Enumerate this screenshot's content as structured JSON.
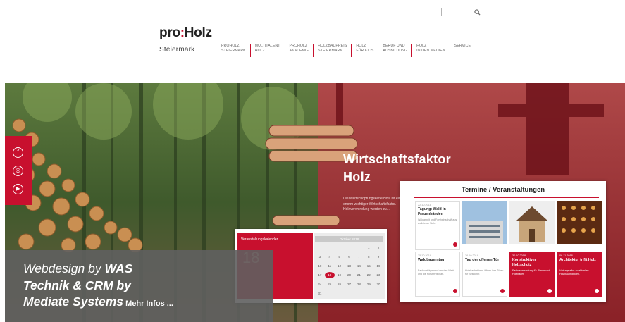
{
  "search": {
    "icon": "search-icon"
  },
  "logo": {
    "brand_a": "pro",
    "brand_sep": ":",
    "brand_b": "Holz",
    "region": "Steiermark"
  },
  "nav": [
    {
      "l1": "PROHOLZ",
      "l2": "STEIERMARK"
    },
    {
      "l1": "MULTITALENT",
      "l2": "HOLZ"
    },
    {
      "l1": "PROHOLZ",
      "l2": "AKADEMIE"
    },
    {
      "l1": "HOLZBAUPREIS",
      "l2": "STEIERMARK"
    },
    {
      "l1": "HOLZ",
      "l2": "FÜR KIDS"
    },
    {
      "l1": "BERUF UND",
      "l2": "AUSBILDUNG"
    },
    {
      "l1": "HOLZ",
      "l2": "IN DEN MEDIEN"
    },
    {
      "l1": "SERVICE",
      "l2": ""
    }
  ],
  "social": [
    "facebook-icon",
    "instagram-icon",
    "youtube-icon"
  ],
  "hero": {
    "title_1": "Wirtschaftsfaktor",
    "title_2": "Holz",
    "text": "Die Wertschöpfungskette Holz ist ein enorm wichtiger Wirtschaftsfaktor. Holzverwendung werden zu..."
  },
  "calendar_tablet": {
    "left_title": "Veranstaltungskalender",
    "big_number": "18",
    "month": "Oktober 2018",
    "days": [
      "",
      "",
      "",
      "",
      "",
      "1",
      "2",
      "3",
      "4",
      "5",
      "6",
      "7",
      "8",
      "9",
      "10",
      "11",
      "12",
      "13",
      "14",
      "15",
      "16",
      "17",
      "18",
      "19",
      "20",
      "21",
      "22",
      "23",
      "24",
      "25",
      "26",
      "27",
      "28",
      "29",
      "30",
      "31",
      "",
      ""
    ],
    "selected": "18"
  },
  "events_card": {
    "title": "Termine / Veranstaltungen",
    "items": [
      {
        "date": "22.10.2018",
        "title": "Tagung: Wald in Frauenhänden",
        "body": "Waldarbeit und Forstwirtschaft aus weiblicher Sicht.",
        "red": false
      },
      {
        "date": "25.10.2018",
        "title": "Waldbauerntag",
        "body": "Fachvorträge rund um den Wald und die Forstwirtschaft.",
        "red": false
      },
      {
        "date": "26.10.2018",
        "title": "Tag der offenen Tür",
        "body": "Holzbaubetriebe öffnen ihre Türen für Besucher.",
        "red": false
      },
      {
        "date": "30.10.2018",
        "title": "Konstruktiver Holzschutz",
        "body": "Fachveranstaltung für Planer und Holzbauer.",
        "red": true
      },
      {
        "date": "06.11.2018",
        "title": "Architektur trifft Holz",
        "body": "Vortragsreihe zu aktuellen Holzbauprojekten.",
        "red": true
      }
    ]
  },
  "overlay": {
    "p1": "Webdesign by ",
    "p1b": "WAS",
    "p2": "Technik & CRM by",
    "p3": "Mediate Systems",
    "more": " Mehr Infos ..."
  }
}
